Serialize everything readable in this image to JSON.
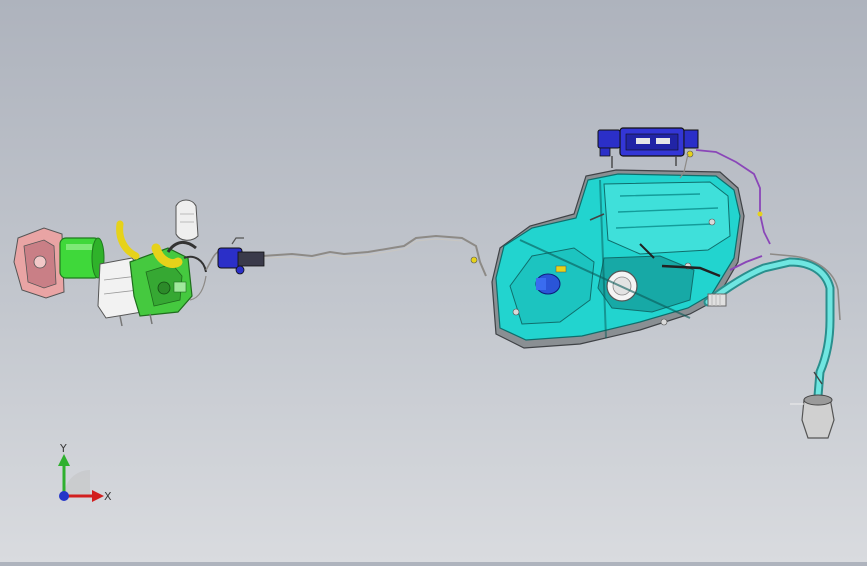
{
  "viewport": {
    "background_top": "#aeb3bd",
    "background_bottom": "#d9dbdf"
  },
  "model": {
    "colors": {
      "tank": "#22d4cf",
      "tank_dark": "#149c9a",
      "engine_green": "#3fd83a",
      "hose_yellow": "#e6d21a",
      "pump_blue": "#2b2fc8",
      "canister_blue": "#3336d6",
      "line_grey": "#8d8a86",
      "purple_line": "#8a46b8",
      "metal": "#d9d9d9"
    }
  },
  "triad": {
    "x_label": "X",
    "y_label": "Y",
    "x_color": "#d21f1f",
    "y_color": "#2fb02f",
    "z_color": "#2436c8"
  }
}
